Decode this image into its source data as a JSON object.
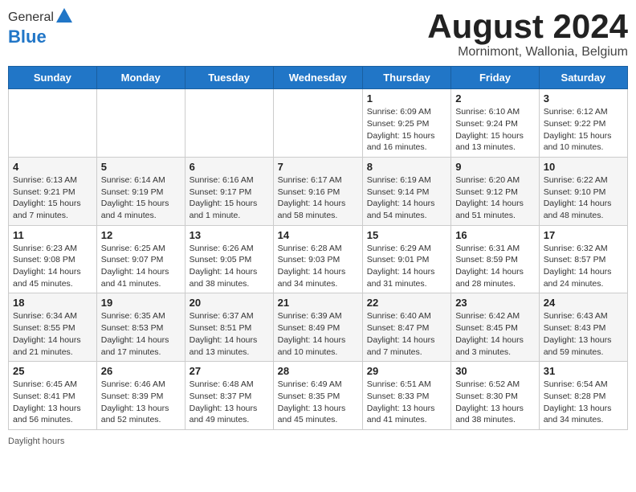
{
  "header": {
    "logo_general": "General",
    "logo_blue": "Blue",
    "month_title": "August 2024",
    "location": "Mornimont, Wallonia, Belgium"
  },
  "weekdays": [
    "Sunday",
    "Monday",
    "Tuesday",
    "Wednesday",
    "Thursday",
    "Friday",
    "Saturday"
  ],
  "footer": {
    "daylight_label": "Daylight hours"
  },
  "weeks": [
    [
      {
        "day": "",
        "info": ""
      },
      {
        "day": "",
        "info": ""
      },
      {
        "day": "",
        "info": ""
      },
      {
        "day": "",
        "info": ""
      },
      {
        "day": "1",
        "info": "Sunrise: 6:09 AM\nSunset: 9:25 PM\nDaylight: 15 hours\nand 16 minutes."
      },
      {
        "day": "2",
        "info": "Sunrise: 6:10 AM\nSunset: 9:24 PM\nDaylight: 15 hours\nand 13 minutes."
      },
      {
        "day": "3",
        "info": "Sunrise: 6:12 AM\nSunset: 9:22 PM\nDaylight: 15 hours\nand 10 minutes."
      }
    ],
    [
      {
        "day": "4",
        "info": "Sunrise: 6:13 AM\nSunset: 9:21 PM\nDaylight: 15 hours\nand 7 minutes."
      },
      {
        "day": "5",
        "info": "Sunrise: 6:14 AM\nSunset: 9:19 PM\nDaylight: 15 hours\nand 4 minutes."
      },
      {
        "day": "6",
        "info": "Sunrise: 6:16 AM\nSunset: 9:17 PM\nDaylight: 15 hours\nand 1 minute."
      },
      {
        "day": "7",
        "info": "Sunrise: 6:17 AM\nSunset: 9:16 PM\nDaylight: 14 hours\nand 58 minutes."
      },
      {
        "day": "8",
        "info": "Sunrise: 6:19 AM\nSunset: 9:14 PM\nDaylight: 14 hours\nand 54 minutes."
      },
      {
        "day": "9",
        "info": "Sunrise: 6:20 AM\nSunset: 9:12 PM\nDaylight: 14 hours\nand 51 minutes."
      },
      {
        "day": "10",
        "info": "Sunrise: 6:22 AM\nSunset: 9:10 PM\nDaylight: 14 hours\nand 48 minutes."
      }
    ],
    [
      {
        "day": "11",
        "info": "Sunrise: 6:23 AM\nSunset: 9:08 PM\nDaylight: 14 hours\nand 45 minutes."
      },
      {
        "day": "12",
        "info": "Sunrise: 6:25 AM\nSunset: 9:07 PM\nDaylight: 14 hours\nand 41 minutes."
      },
      {
        "day": "13",
        "info": "Sunrise: 6:26 AM\nSunset: 9:05 PM\nDaylight: 14 hours\nand 38 minutes."
      },
      {
        "day": "14",
        "info": "Sunrise: 6:28 AM\nSunset: 9:03 PM\nDaylight: 14 hours\nand 34 minutes."
      },
      {
        "day": "15",
        "info": "Sunrise: 6:29 AM\nSunset: 9:01 PM\nDaylight: 14 hours\nand 31 minutes."
      },
      {
        "day": "16",
        "info": "Sunrise: 6:31 AM\nSunset: 8:59 PM\nDaylight: 14 hours\nand 28 minutes."
      },
      {
        "day": "17",
        "info": "Sunrise: 6:32 AM\nSunset: 8:57 PM\nDaylight: 14 hours\nand 24 minutes."
      }
    ],
    [
      {
        "day": "18",
        "info": "Sunrise: 6:34 AM\nSunset: 8:55 PM\nDaylight: 14 hours\nand 21 minutes."
      },
      {
        "day": "19",
        "info": "Sunrise: 6:35 AM\nSunset: 8:53 PM\nDaylight: 14 hours\nand 17 minutes."
      },
      {
        "day": "20",
        "info": "Sunrise: 6:37 AM\nSunset: 8:51 PM\nDaylight: 14 hours\nand 13 minutes."
      },
      {
        "day": "21",
        "info": "Sunrise: 6:39 AM\nSunset: 8:49 PM\nDaylight: 14 hours\nand 10 minutes."
      },
      {
        "day": "22",
        "info": "Sunrise: 6:40 AM\nSunset: 8:47 PM\nDaylight: 14 hours\nand 7 minutes."
      },
      {
        "day": "23",
        "info": "Sunrise: 6:42 AM\nSunset: 8:45 PM\nDaylight: 14 hours\nand 3 minutes."
      },
      {
        "day": "24",
        "info": "Sunrise: 6:43 AM\nSunset: 8:43 PM\nDaylight: 13 hours\nand 59 minutes."
      }
    ],
    [
      {
        "day": "25",
        "info": "Sunrise: 6:45 AM\nSunset: 8:41 PM\nDaylight: 13 hours\nand 56 minutes."
      },
      {
        "day": "26",
        "info": "Sunrise: 6:46 AM\nSunset: 8:39 PM\nDaylight: 13 hours\nand 52 minutes."
      },
      {
        "day": "27",
        "info": "Sunrise: 6:48 AM\nSunset: 8:37 PM\nDaylight: 13 hours\nand 49 minutes."
      },
      {
        "day": "28",
        "info": "Sunrise: 6:49 AM\nSunset: 8:35 PM\nDaylight: 13 hours\nand 45 minutes."
      },
      {
        "day": "29",
        "info": "Sunrise: 6:51 AM\nSunset: 8:33 PM\nDaylight: 13 hours\nand 41 minutes."
      },
      {
        "day": "30",
        "info": "Sunrise: 6:52 AM\nSunset: 8:30 PM\nDaylight: 13 hours\nand 38 minutes."
      },
      {
        "day": "31",
        "info": "Sunrise: 6:54 AM\nSunset: 8:28 PM\nDaylight: 13 hours\nand 34 minutes."
      }
    ]
  ]
}
